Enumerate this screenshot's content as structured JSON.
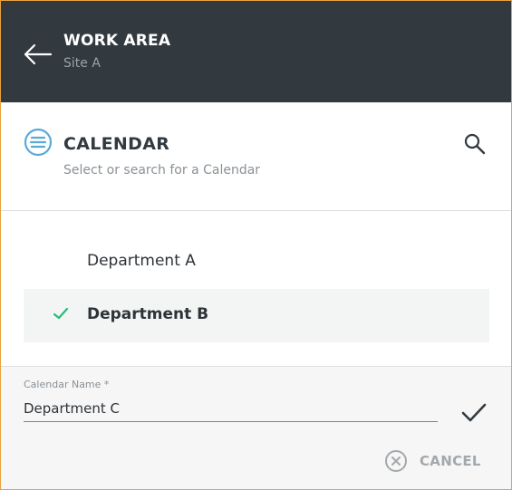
{
  "header": {
    "title": "WORK AREA",
    "subtitle": "Site A",
    "back_icon": "arrow-left-icon",
    "background_color": "#323a40"
  },
  "calendar": {
    "title": "CALENDAR",
    "subtitle": "Select or search for a Calendar",
    "icon": "list-circle-icon",
    "accent_color": "#5aaad8",
    "search_icon": "search-icon"
  },
  "list": {
    "items": [
      {
        "label": "Department A",
        "selected": false
      },
      {
        "label": "Department B",
        "selected": true
      }
    ],
    "check_color": "#2db87a"
  },
  "form": {
    "field_label": "Calendar Name *",
    "field_value": "Department C",
    "confirm_icon": "checkmark-icon",
    "cancel_label": "CANCEL",
    "cancel_icon": "close-circle-icon"
  }
}
